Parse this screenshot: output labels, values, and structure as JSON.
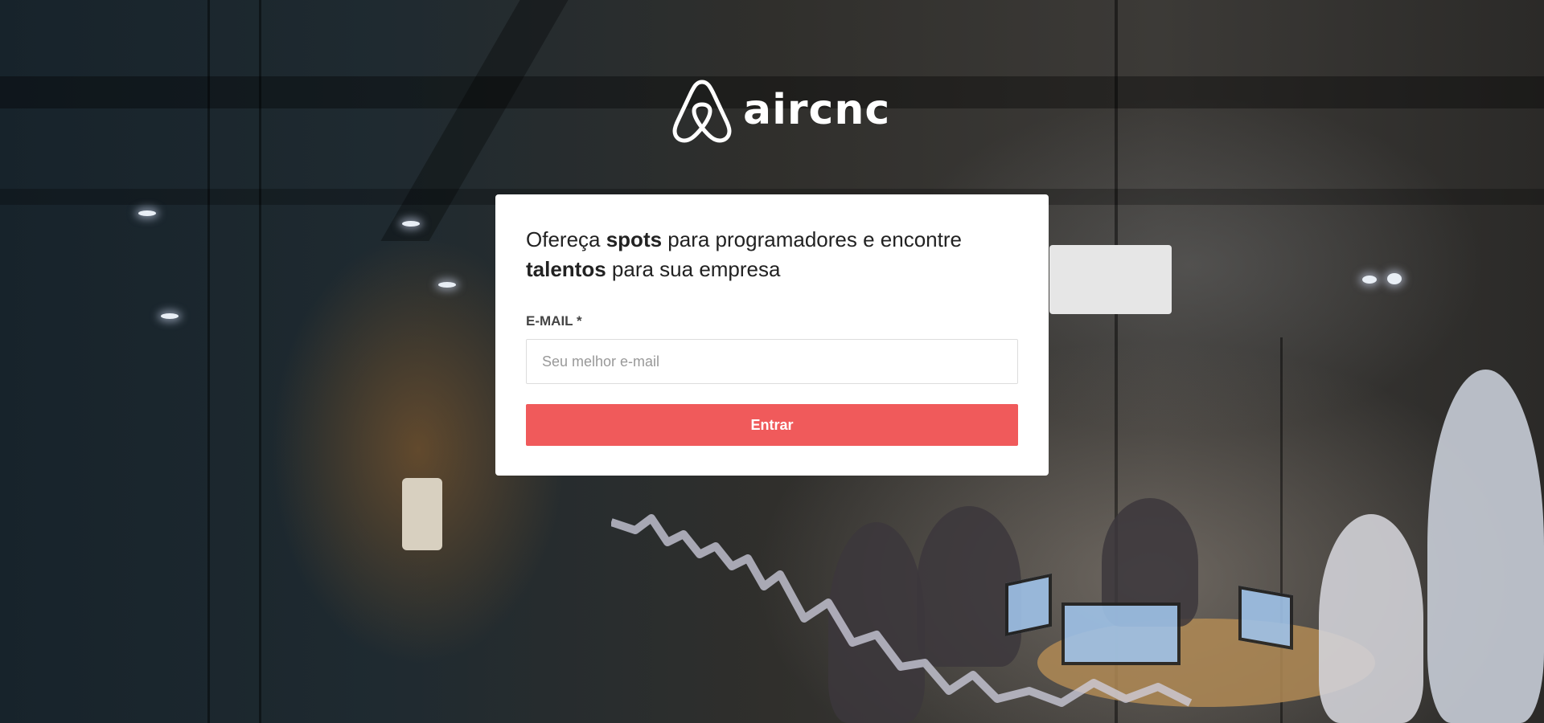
{
  "brand": {
    "logo_icon": "airbnb-belo-icon",
    "name": "aircnc"
  },
  "card": {
    "headline": {
      "part1": "Ofereça ",
      "bold1": "spots",
      "part2": " para programadores e encontre ",
      "bold2": "talentos",
      "part3": " para sua empresa"
    },
    "email_label": "E-MAIL *",
    "email_placeholder": "Seu melhor e-mail",
    "email_value": "",
    "submit_label": "Entrar"
  },
  "colors": {
    "accent": "#f05a5b",
    "card_background": "#ffffff",
    "text": "#222222"
  }
}
